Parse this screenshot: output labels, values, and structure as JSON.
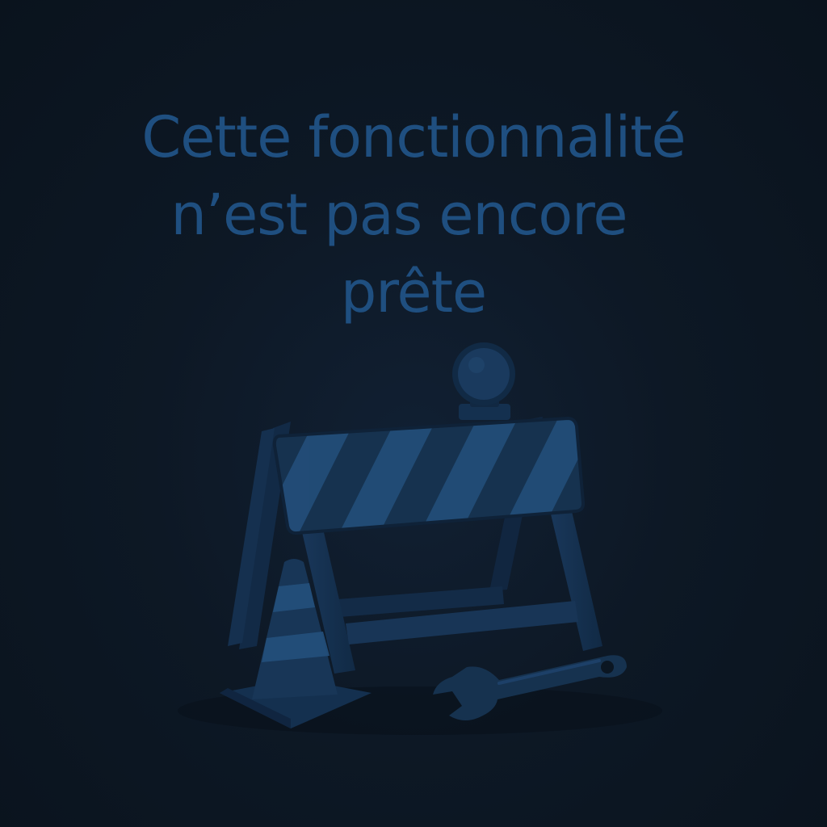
{
  "message": {
    "line1": "Cette fonctionnalité",
    "line2": "n’est pas encore",
    "line3": "prête"
  },
  "illustration": {
    "icons": [
      "warning-light-icon",
      "road-barrier-icon",
      "traffic-cone-icon",
      "wrench-icon"
    ]
  },
  "colors": {
    "background": "#0c1622",
    "text": "#1f4f80",
    "illustration_dark": "#152d4a",
    "illustration_light": "#234d7a"
  }
}
